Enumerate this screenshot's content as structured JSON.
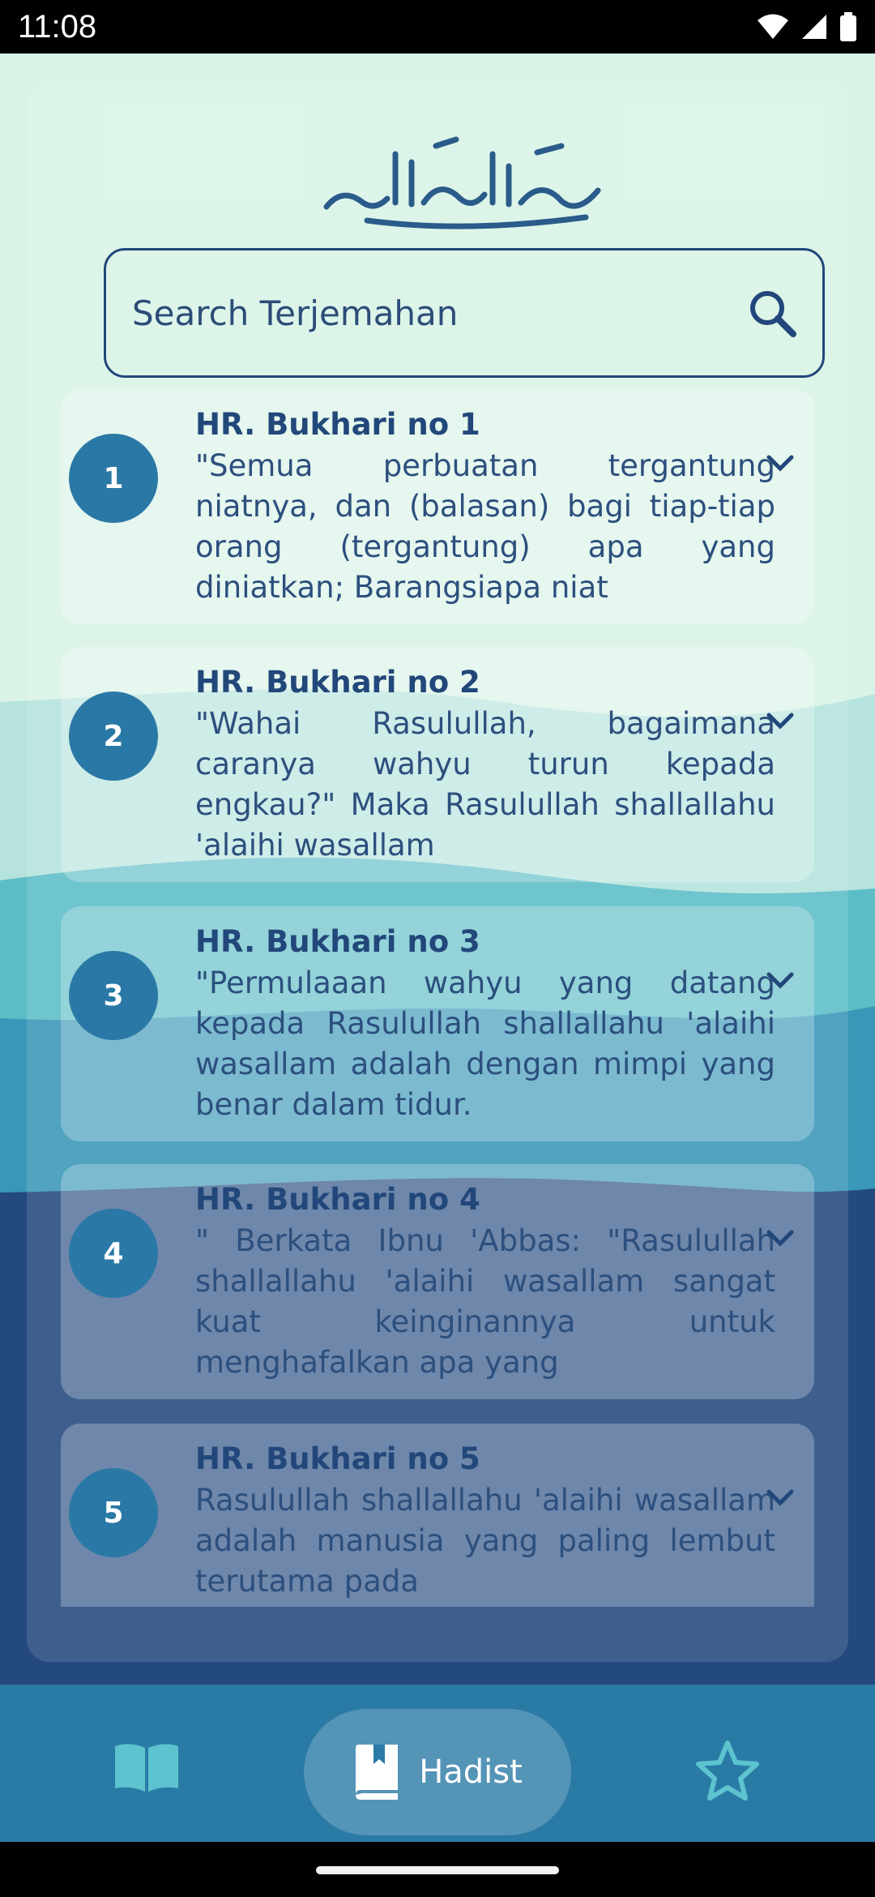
{
  "status_bar": {
    "time": "11:08"
  },
  "search": {
    "placeholder": "Search Terjemahan"
  },
  "hadith_list": [
    {
      "number": "1",
      "title": "HR. Bukhari no 1",
      "preview": "\"Semua perbuatan tergantung niatnya, dan (balasan) bagi tiap-tiap orang (tergantung) apa yang diniatkan; Barangsiapa niat"
    },
    {
      "number": "2",
      "title": "HR. Bukhari no 2",
      "preview": "\"Wahai Rasulullah, bagaimana caranya wahyu turun kepada engkau?\" Maka Rasulullah shallallahu 'alaihi wasallam"
    },
    {
      "number": "3",
      "title": "HR. Bukhari no 3",
      "preview": "\"Permulaaan wahyu yang datang kepada Rasulullah shallallahu 'alaihi wasallam adalah dengan mimpi yang benar dalam tidur."
    },
    {
      "number": "4",
      "title": "HR. Bukhari no 4",
      "preview": "\" Berkata Ibnu 'Abbas: \"Rasulullah shallallahu 'alaihi wasallam sangat kuat keinginannya untuk menghafalkan apa yang"
    },
    {
      "number": "5",
      "title": "HR. Bukhari no 5",
      "preview": "Rasulullah shallallahu 'alaihi wasallam adalah manusia yang paling lembut terutama pada"
    }
  ],
  "bottom_nav": {
    "items": [
      {
        "icon": "book-open-icon",
        "label": ""
      },
      {
        "icon": "book-bookmark-icon",
        "label": "Hadist",
        "active": true
      },
      {
        "icon": "star-outline-icon",
        "label": ""
      }
    ]
  },
  "colors": {
    "primary": "#22477a",
    "badge": "#2a78a6",
    "nav_bar": "#2a7aa6",
    "bg_light": "#d7f3e4",
    "wave_teal": "#52b9c5",
    "wave_dark": "#23467e"
  }
}
